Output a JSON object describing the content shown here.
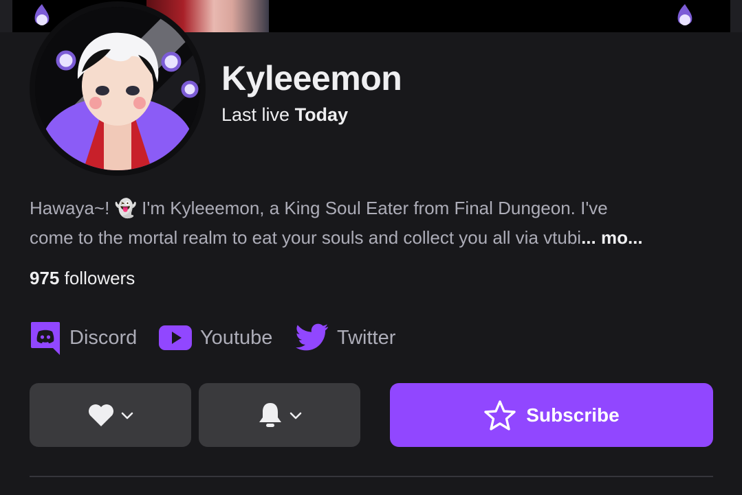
{
  "channel": {
    "name": "Kyleeemon",
    "last_live_prefix": "Last live",
    "last_live_value": "Today",
    "bio_line1": "Hawaya~! 👻 I'm Kyleeemon, a King Soul Eater from Final Dungeon. I've",
    "bio_line2": "come to the mortal realm to eat your souls and collect you all via vtubi",
    "bio_more": "... mo...",
    "followers_count": "975",
    "followers_label": "followers"
  },
  "social_links": [
    {
      "label": "Discord",
      "icon": "discord-icon"
    },
    {
      "label": "Youtube",
      "icon": "youtube-icon"
    },
    {
      "label": "Twitter",
      "icon": "twitter-icon"
    }
  ],
  "actions": {
    "follow_icon": "heart-icon",
    "notify_icon": "bell-icon",
    "subscribe_label": "Subscribe",
    "subscribe_icon": "star-icon"
  },
  "colors": {
    "accent": "#9147ff",
    "background": "#18181b",
    "button_gray": "#3a3a3d"
  }
}
